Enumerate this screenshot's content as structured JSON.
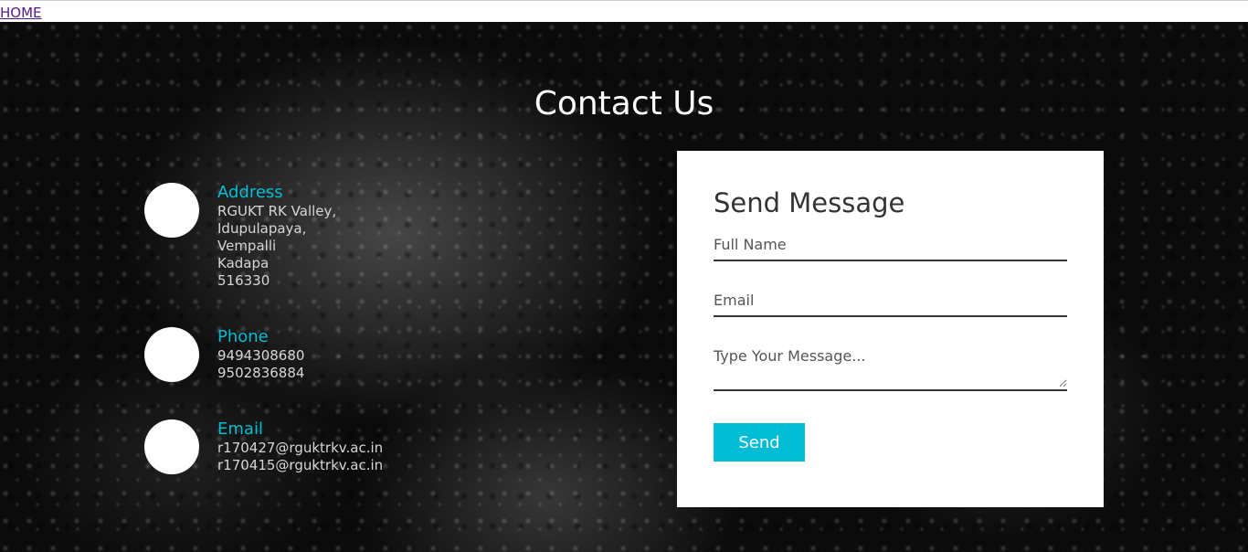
{
  "nav": {
    "home_label": "HOME"
  },
  "hero": {
    "title": "Contact Us"
  },
  "contact": {
    "address": {
      "heading": "Address",
      "lines": [
        "RGUKT RK Valley,",
        "Idupulapaya,",
        "Vempalli",
        "Kadapa",
        "516330"
      ]
    },
    "phone": {
      "heading": "Phone",
      "lines": [
        "9494308680",
        "9502836884"
      ]
    },
    "email": {
      "heading": "Email",
      "lines": [
        "r170427@rguktrkv.ac.in",
        "r170415@rguktrkv.ac.in"
      ]
    }
  },
  "form": {
    "title": "Send Message",
    "name_placeholder": "Full Name",
    "email_placeholder": "Email",
    "message_placeholder": "Type Your Message...",
    "send_label": "Send"
  },
  "colors": {
    "accent": "#00bcd4",
    "card": "#ffffff",
    "background": "#0b0b0b",
    "link": "#551a8b"
  }
}
